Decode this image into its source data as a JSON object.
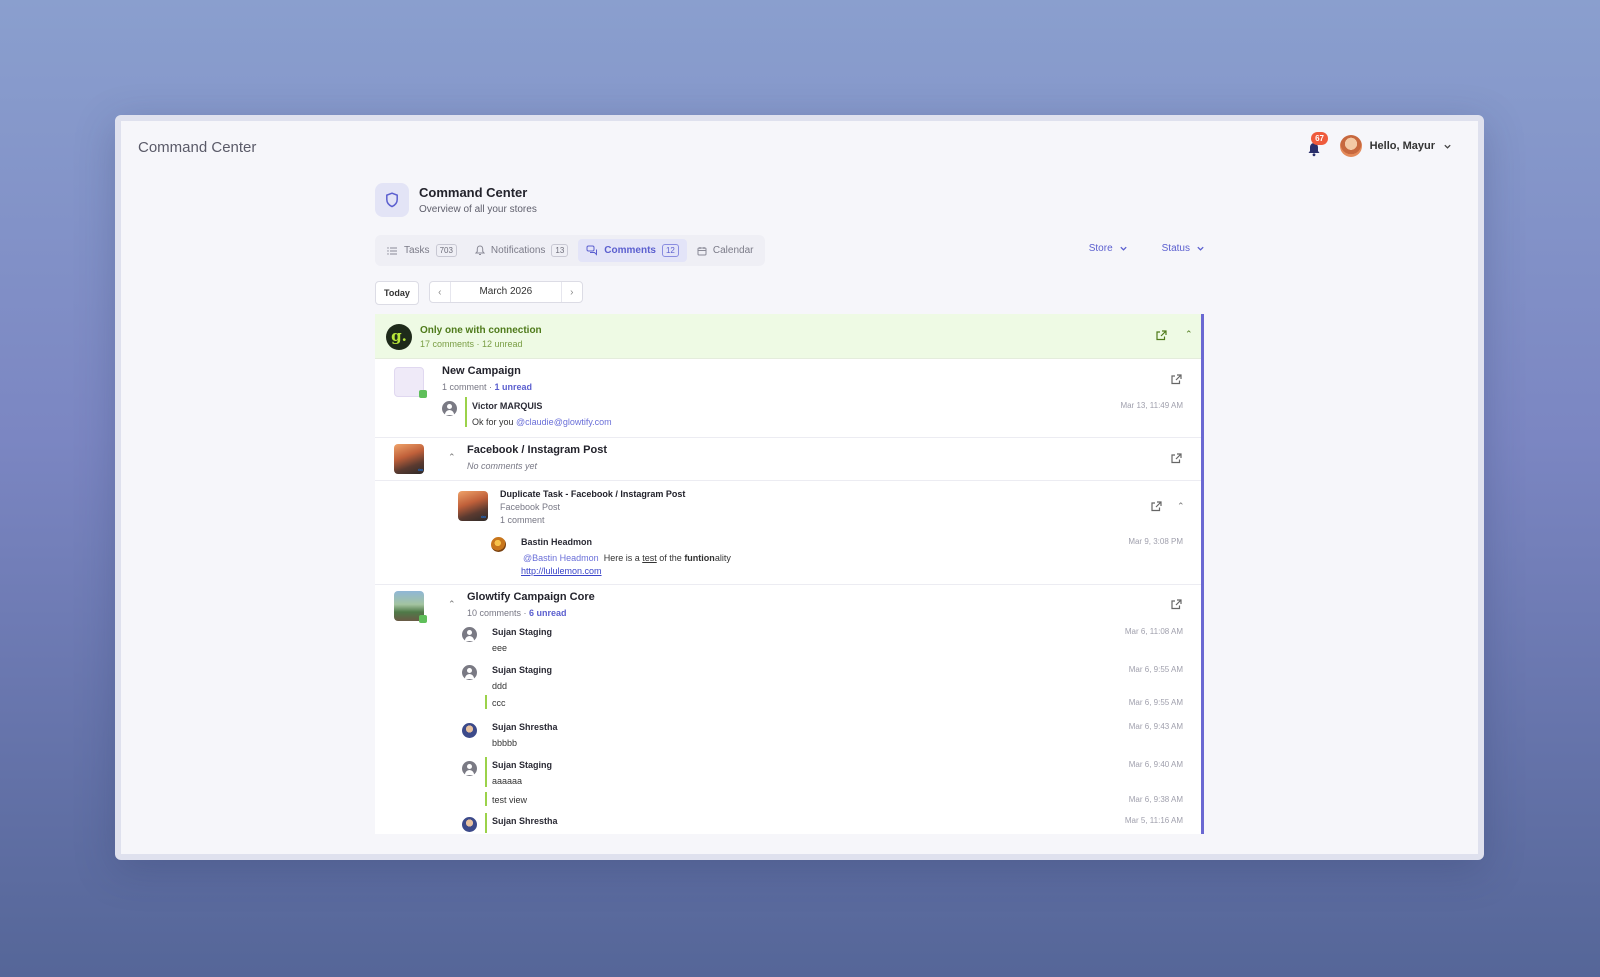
{
  "app": {
    "title": "Command Center"
  },
  "header": {
    "notification_count": "67",
    "greeting": "Hello, Mayur"
  },
  "page": {
    "title": "Command Center",
    "subtitle": "Overview of all your stores"
  },
  "tabs": [
    {
      "label": "Tasks",
      "count": "703"
    },
    {
      "label": "Notifications",
      "count": "13"
    },
    {
      "label": "Comments",
      "count": "12"
    },
    {
      "label": "Calendar"
    }
  ],
  "filters": {
    "store": "Store",
    "status": "Status"
  },
  "datebar": {
    "today": "Today",
    "month": "March 2026"
  },
  "store": {
    "logo": "g.",
    "name": "Only one with connection",
    "meta": "17 comments · 12 unread"
  },
  "tasks": {
    "new_campaign": {
      "title": "New Campaign",
      "comments": "1 comment",
      "unread": "1 unread",
      "comment": {
        "author": "Victor MARQUIS",
        "text": "Ok for you",
        "mention": "@claudie@glowtify.com",
        "time": "Mar 13, 11:49 AM"
      }
    },
    "fb_post": {
      "title": "Facebook / Instagram Post",
      "empty": "No comments yet"
    },
    "duplicate": {
      "title": "Duplicate Task - Facebook / Instagram Post",
      "subtitle": "Facebook Post",
      "comments": "1 comment",
      "comment": {
        "author": "Bastin Headmon",
        "mention": "@Bastin Headmon",
        "text_a": "Here is a",
        "text_b": "test",
        "text_c": "of the",
        "text_d": "funtion",
        "text_e": "ality",
        "link": "http://lululemon.com",
        "time": "Mar 9, 3:08 PM"
      }
    },
    "core": {
      "title": "Glowtify Campaign Core",
      "comments": "10 comments",
      "unread": "6 unread",
      "comments_list": [
        {
          "author": "Sujan Staging",
          "text": "eee",
          "time": "Mar 6, 11:08 AM"
        },
        {
          "author": "Sujan Staging",
          "text": "ddd",
          "time": "Mar 6, 9:55 AM"
        },
        {
          "author": "",
          "text": "ccc",
          "time": "Mar 6, 9:55 AM"
        },
        {
          "author": "Sujan Shrestha",
          "text": "bbbbb",
          "time": "Mar 6, 9:43 AM"
        },
        {
          "author": "Sujan Staging",
          "text": "aaaaaa",
          "time": "Mar 6, 9:40 AM"
        },
        {
          "author": "",
          "text": "test view",
          "time": "Mar 6, 9:38 AM"
        },
        {
          "author": "Sujan Shrestha",
          "text": "",
          "time": "Mar 5, 11:16 AM"
        }
      ]
    }
  }
}
